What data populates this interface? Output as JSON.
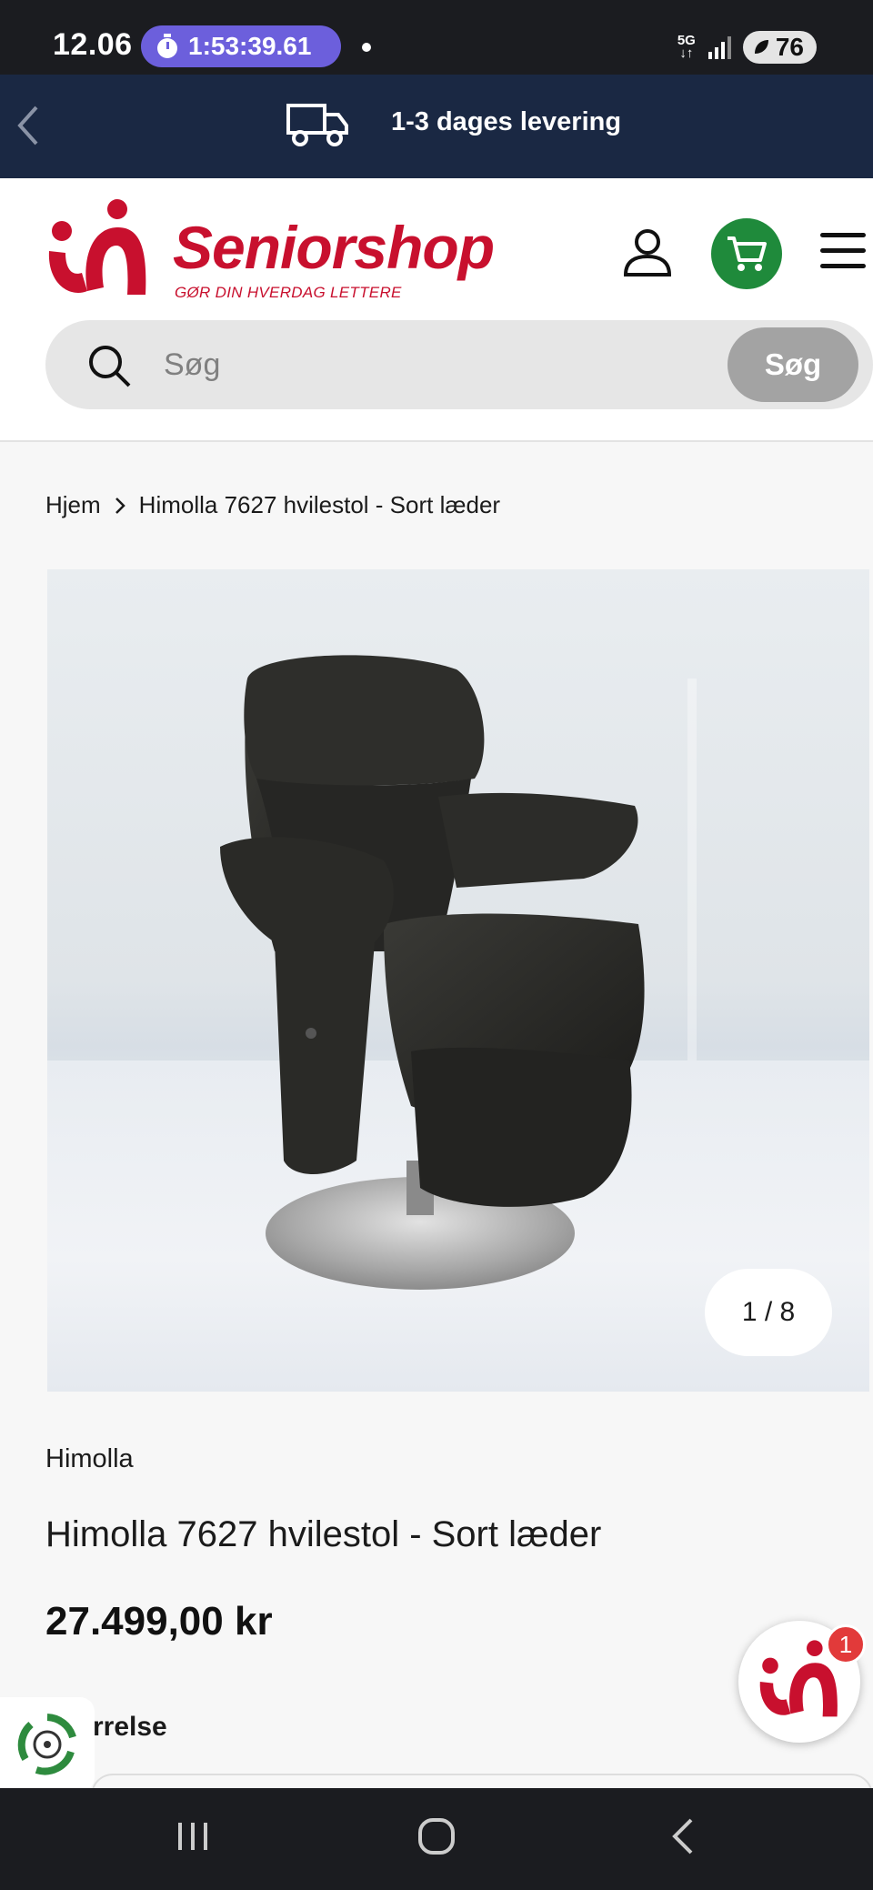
{
  "status_bar": {
    "time": "12.06",
    "timer": "1:53:39.61",
    "network": "5G",
    "battery": "76"
  },
  "delivery_banner": {
    "text": "1-3 dages levering"
  },
  "header": {
    "logo_word": "Seniorshop",
    "logo_tagline": "GØR DIN HVERDAG LETTERE",
    "search_placeholder": "Søg",
    "search_button": "Søg"
  },
  "breadcrumb": {
    "home": "Hjem",
    "current": "Himolla 7627 hvilestol - Sort læder"
  },
  "gallery": {
    "counter": "1 / 8"
  },
  "product": {
    "brand": "Himolla",
    "title": "Himolla 7627 hvilestol - Sort læder",
    "price": "27.499,00 kr",
    "size_label": "rrelse"
  },
  "chat_badge": {
    "count": "1"
  },
  "colors": {
    "brand_red": "#c8102e",
    "banner_navy": "#1a2843",
    "cart_green": "#1f8a3b",
    "timer_purple": "#6c5fdc"
  }
}
